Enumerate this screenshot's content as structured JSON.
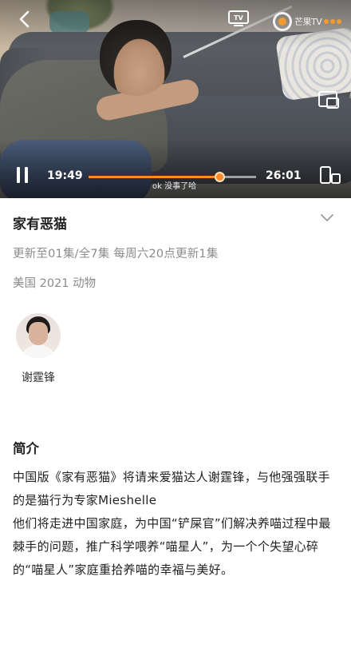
{
  "player": {
    "current_time": "19:49",
    "total_time": "26:01",
    "progress": 0.78,
    "danmaku": "ok 没事了哈",
    "logo_text": "芒果TV",
    "tv_label": "TV"
  },
  "show": {
    "title": "家有恶猫",
    "update_info": "更新至01集/全7集 每周六20点更新1集",
    "meta": "美国 2021 动物"
  },
  "cast": [
    {
      "name": "谢霆锋"
    }
  ],
  "intro": {
    "heading": "简介",
    "paragraph1": "中国版《家有恶猫》将请来爱猫达人谢霆锋，与他强强联手的是猫行为专家Mieshelle",
    "paragraph2": "他们将走进中国家庭，为中国“铲屎官”们解决养喵过程中最棘手的问题，推广科学喂养“喵星人”，为一个个失望心碎的“喵星人”家庭重拾养喵的幸福与美好。"
  },
  "colors": {
    "accent": "#ff8a24",
    "secondary_text": "#8b8b8b"
  },
  "icons": [
    "back-icon",
    "tv-cast-icon",
    "pip-icon",
    "pause-icon",
    "rotate-screen-icon",
    "chevron-down-icon"
  ]
}
